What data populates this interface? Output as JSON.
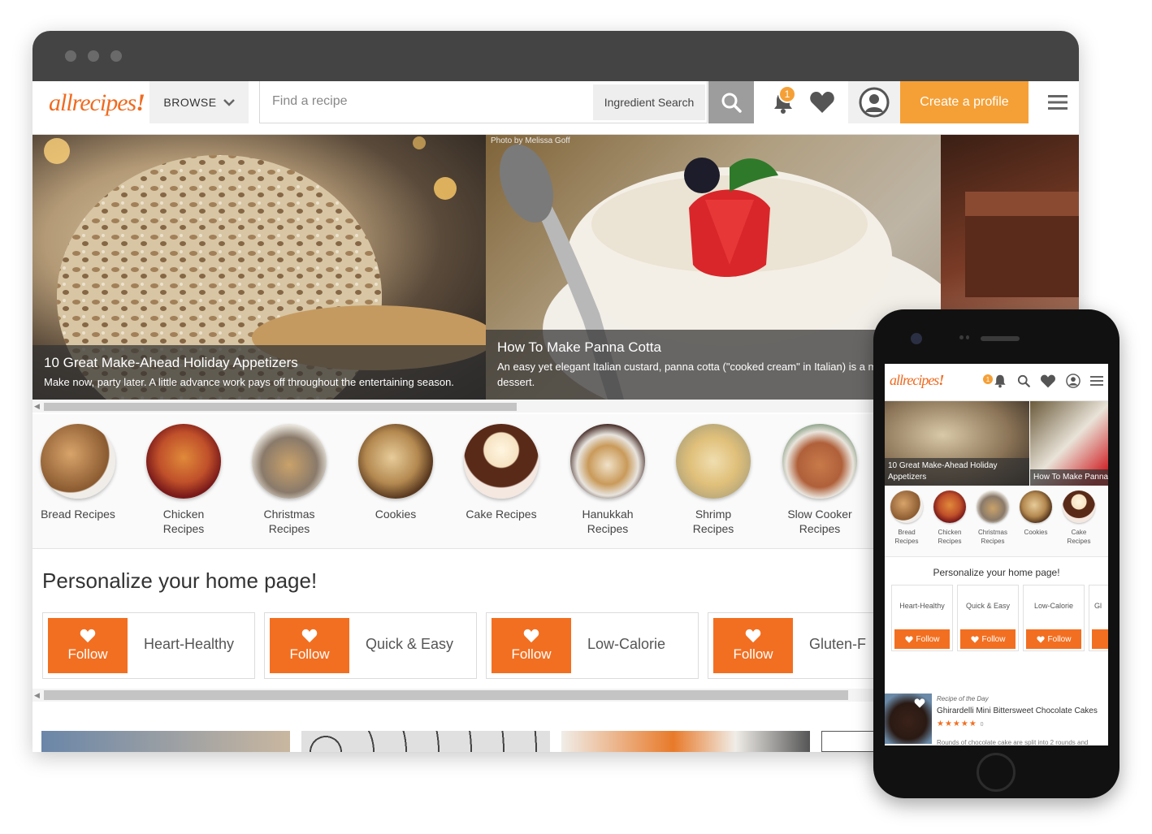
{
  "desktop": {
    "nav": {
      "logo": "allrecipes",
      "browse": "BROWSE",
      "search_placeholder": "Find a recipe",
      "ingredient_search": "Ingredient Search",
      "notification_count": "1",
      "create_profile": "Create a profile"
    },
    "hero": {
      "photo_credit": "Photo by Melissa Goff",
      "slides": [
        {
          "title": "10 Great Make-Ahead Holiday Appetizers",
          "subtitle": "Make now, party later. A little advance work pays off throughout the entertaining season."
        },
        {
          "title": "How To Make Panna Cotta",
          "subtitle": "An easy yet elegant Italian custard, panna cotta (\"cooked cream\" in Italian) is a make-ahead dessert."
        }
      ]
    },
    "categories": [
      {
        "line1": "Bread Recipes",
        "line2": ""
      },
      {
        "line1": "Chicken",
        "line2": "Recipes"
      },
      {
        "line1": "Christmas",
        "line2": "Recipes"
      },
      {
        "line1": "Cookies",
        "line2": ""
      },
      {
        "line1": "Cake Recipes",
        "line2": ""
      },
      {
        "line1": "Hanukkah",
        "line2": "Recipes"
      },
      {
        "line1": "Shrimp",
        "line2": "Recipes"
      },
      {
        "line1": "Slow Cooker",
        "line2": "Recipes"
      }
    ],
    "personalize_title": "Personalize your home page!",
    "follow_label": "Follow",
    "topics": [
      "Heart-Healthy",
      "Quick & Easy",
      "Low-Calorie",
      "Gluten-F"
    ]
  },
  "mobile": {
    "logo": "allrecipes",
    "notification_count": "1",
    "hero": [
      "10 Great Make-Ahead Holiday Appetizers",
      "How To Make Panna"
    ],
    "categories": [
      {
        "line1": "Bread",
        "line2": "Recipes"
      },
      {
        "line1": "Chicken",
        "line2": "Recipes"
      },
      {
        "line1": "Christmas",
        "line2": "Recipes"
      },
      {
        "line1": "Cookies",
        "line2": ""
      },
      {
        "line1": "Cake",
        "line2": "Recipes"
      }
    ],
    "personalize_title": "Personalize your home page!",
    "follow_label": "Follow",
    "topics": [
      "Heart-Healthy",
      "Quick & Easy",
      "Low-Calorie",
      "Gl"
    ],
    "recipe_of_day": {
      "kicker": "Recipe of the Day",
      "title": "Ghirardelli Mini Bittersweet Chocolate Cakes",
      "stars": "★★★★★",
      "count": "0",
      "description": "Rounds of chocolate cake are split into 2 rounds and"
    }
  },
  "colors": {
    "brand_orange": "#f26f21",
    "accent_orange": "#f5a036",
    "chrome": "#444444"
  }
}
